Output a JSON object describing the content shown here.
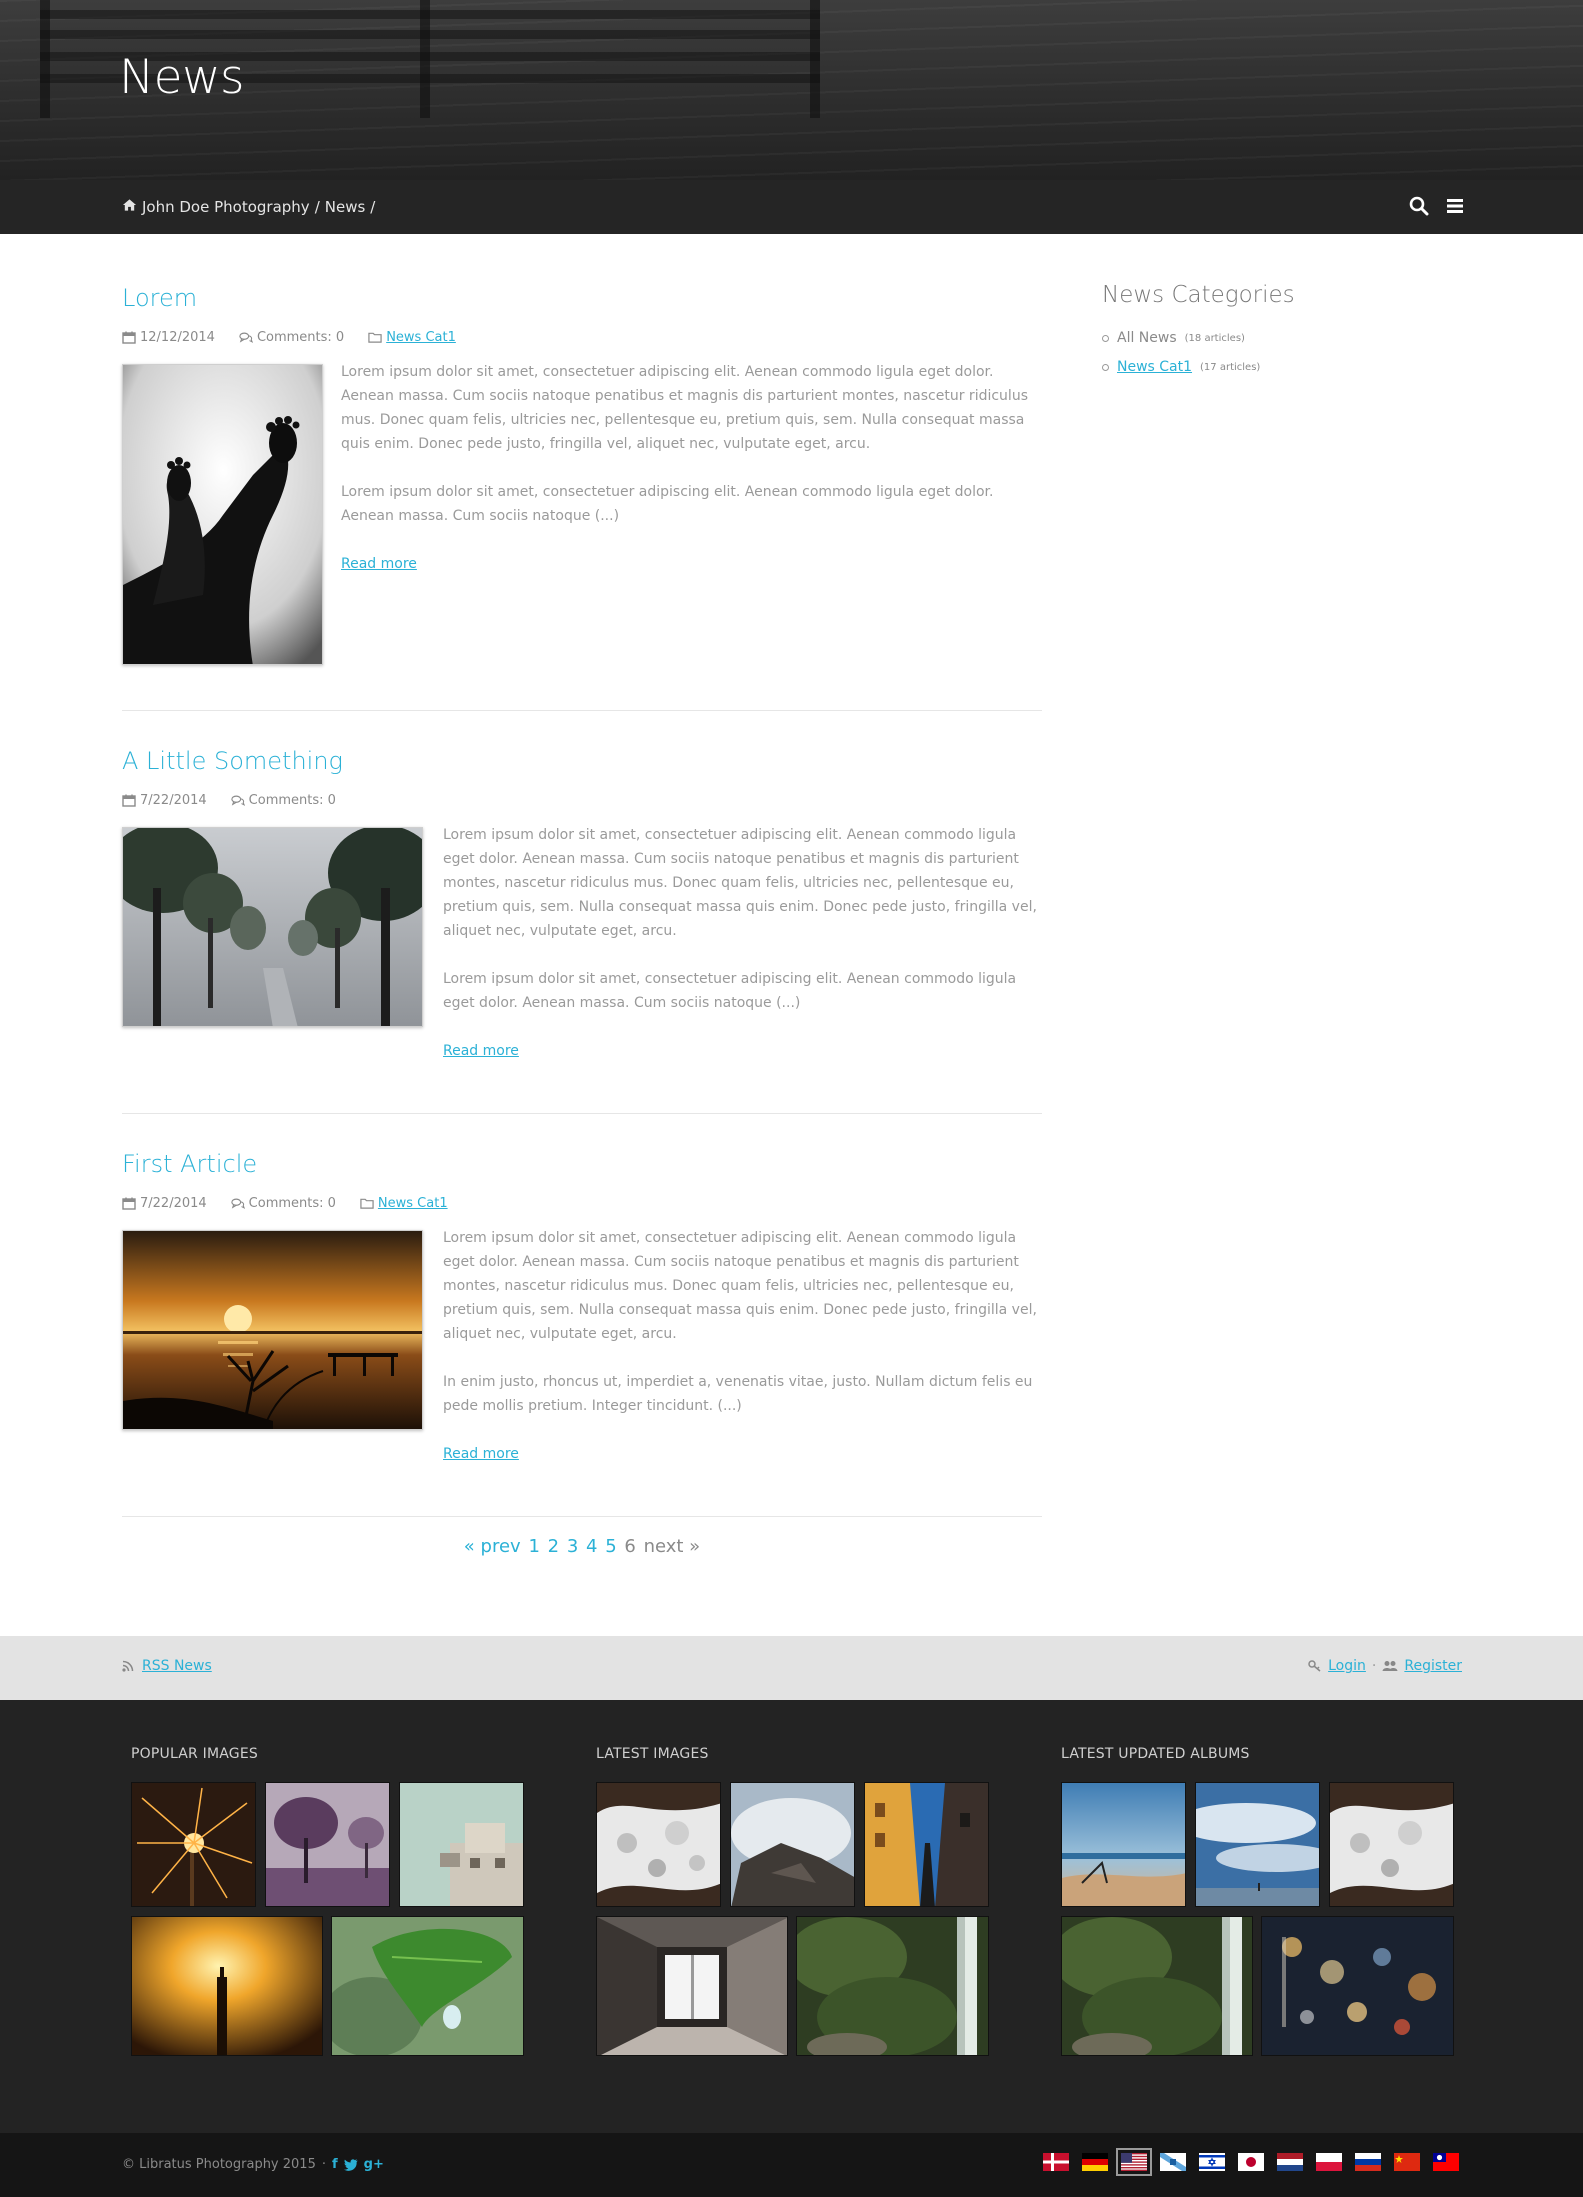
{
  "hero": {
    "title": "News"
  },
  "breadcrumb": {
    "home": "John Doe Photography",
    "sep": "/",
    "current": "News"
  },
  "articles": [
    {
      "title": "Lorem",
      "date": "12/12/2014",
      "comments": "Comments: 0",
      "category": "News Cat1",
      "para1": "Lorem ipsum dolor sit amet, consectetuer adipiscing elit. Aenean commodo ligula eget dolor. Aenean massa. Cum sociis natoque penatibus et magnis dis parturient montes, nascetur ridiculus mus. Donec quam felis, ultricies nec, pellentesque eu, pretium quis, sem. Nulla consequat massa quis enim. Donec pede justo, fringilla vel, aliquet nec, vulputate eget, arcu.",
      "para2": "Lorem ipsum dolor sit amet, consectetuer adipiscing elit. Aenean commodo ligula eget dolor. Aenean massa. Cum sociis natoque (...)",
      "read_more": "Read more"
    },
    {
      "title": "A Little Something",
      "date": "7/22/2014",
      "comments": "Comments: 0",
      "category": "",
      "para1": "Lorem ipsum dolor sit amet, consectetuer adipiscing elit. Aenean commodo ligula eget dolor. Aenean massa. Cum sociis natoque penatibus et magnis dis parturient montes, nascetur ridiculus mus. Donec quam felis, ultricies nec, pellentesque eu, pretium quis, sem. Nulla consequat massa quis enim. Donec pede justo, fringilla vel, aliquet nec, vulputate eget, arcu.",
      "para2": "Lorem ipsum dolor sit amet, consectetuer adipiscing elit. Aenean commodo ligula eget dolor. Aenean massa. Cum sociis natoque (...)",
      "read_more": "Read more"
    },
    {
      "title": "First Article",
      "date": "7/22/2014",
      "comments": "Comments: 0",
      "category": "News Cat1",
      "para1": "Lorem ipsum dolor sit amet, consectetuer adipiscing elit. Aenean commodo ligula eget dolor. Aenean massa. Cum sociis natoque penatibus et magnis dis parturient montes, nascetur ridiculus mus. Donec quam felis, ultricies nec, pellentesque eu, pretium quis, sem. Nulla consequat massa quis enim. Donec pede justo, fringilla vel, aliquet nec, vulputate eget, arcu.",
      "para2": "In enim justo, rhoncus ut, imperdiet a, venenatis vitae, justo. Nullam dictum felis eu pede mollis pretium. Integer tincidunt. (...)",
      "read_more": "Read more"
    }
  ],
  "pagination": {
    "prev": "« prev",
    "pages": [
      "1",
      "2",
      "3",
      "4",
      "5"
    ],
    "current": "6",
    "next": "next »"
  },
  "sidebar": {
    "title": "News Categories",
    "items": [
      {
        "label": "All News",
        "count": "(18 articles)"
      },
      {
        "label": "News Cat1",
        "count": "(17 articles)"
      }
    ]
  },
  "utility": {
    "rss": "RSS News",
    "login": "Login",
    "separator": "·",
    "register": "Register"
  },
  "footer": {
    "popular": "POPULAR IMAGES",
    "latest": "LATEST IMAGES",
    "albums": "LATEST UPDATED ALBUMS",
    "copyright": "© Libratus Photography 2015",
    "dot": "·",
    "social": {
      "facebook": "f",
      "google": "g+"
    }
  },
  "languages": [
    "Danish",
    "German",
    "English (US)",
    "Galician",
    "Hebrew",
    "Japanese",
    "Dutch",
    "Polish",
    "Russian",
    "Chinese",
    "Taiwanese"
  ],
  "colors": {
    "accent": "#2bb1d6",
    "navbar": "#252525",
    "footer": "#232323",
    "bottombar": "#151515",
    "utility": "#e3e3e3"
  }
}
